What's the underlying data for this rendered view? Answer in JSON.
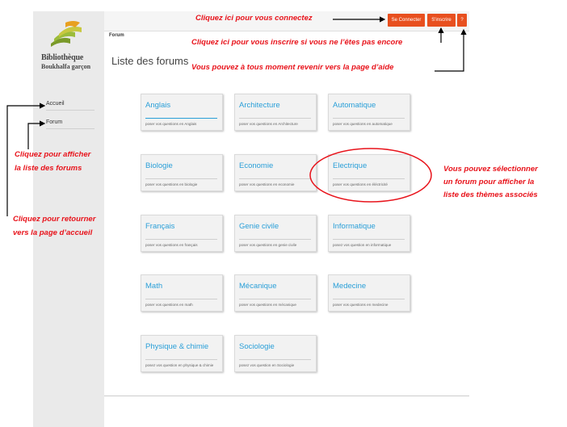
{
  "sidebar": {
    "brand_line1": "Bibliothèque",
    "brand_line2": "Boukhalfa garçon",
    "items": [
      {
        "label": "Accueil"
      },
      {
        "label": "Forum"
      }
    ]
  },
  "topbar": {
    "connect_label": "Se Connecter",
    "signup_label": "S'inscrire",
    "help_label": "?"
  },
  "breadcrumb": "Forum",
  "page_title": "Liste des forums",
  "forums": [
    {
      "name": "Anglais",
      "desc": "poser vos questions en Anglais"
    },
    {
      "name": "Architecture",
      "desc": "poser vos questions en Architecture"
    },
    {
      "name": "Automatique",
      "desc": "poser vos questions en automatique"
    },
    {
      "name": "Biologie",
      "desc": "poser vos questions en biologie"
    },
    {
      "name": "Economie",
      "desc": "poser vos questions en economie"
    },
    {
      "name": "Electrique",
      "desc": "poser vos questions en éléctricité"
    },
    {
      "name": "Français",
      "desc": "poser vos questions en français"
    },
    {
      "name": "Genie civile",
      "desc": "poser vos questions en genie civile"
    },
    {
      "name": "Informatique",
      "desc": "posez vos question en informatique"
    },
    {
      "name": "Math",
      "desc": "poser vos questions en math"
    },
    {
      "name": "Mécanique",
      "desc": "poser vos questions en mécanique"
    },
    {
      "name": "Medecine",
      "desc": "poser vos questions en medecine"
    },
    {
      "name": "Physique & chimie",
      "desc": "posez vos question en physique & chimie"
    },
    {
      "name": "Sociologie",
      "desc": "posez vos question en Sociologie"
    }
  ],
  "annotations": {
    "connect": "Cliquez ici pour vous connectez",
    "signup": "Cliquez ici pour vous inscrire si vous ne l’êtes pas encore",
    "help": "Vous pouvez à tous moment revenir vers la page d’aide",
    "forum_list_1": "Cliquez pour afficher",
    "forum_list_2": "la liste des forums",
    "home_1": "Cliquez pour retourner",
    "home_2": "vers la page d’accueil",
    "select_1": "Vous pouvez sélectionner",
    "select_2": "un forum pour afficher la",
    "select_3": "liste des thèmes associés"
  },
  "colors": {
    "accent_button": "#e8501f",
    "link_blue": "#2a9fd8",
    "annotation_red": "#e8131b"
  }
}
